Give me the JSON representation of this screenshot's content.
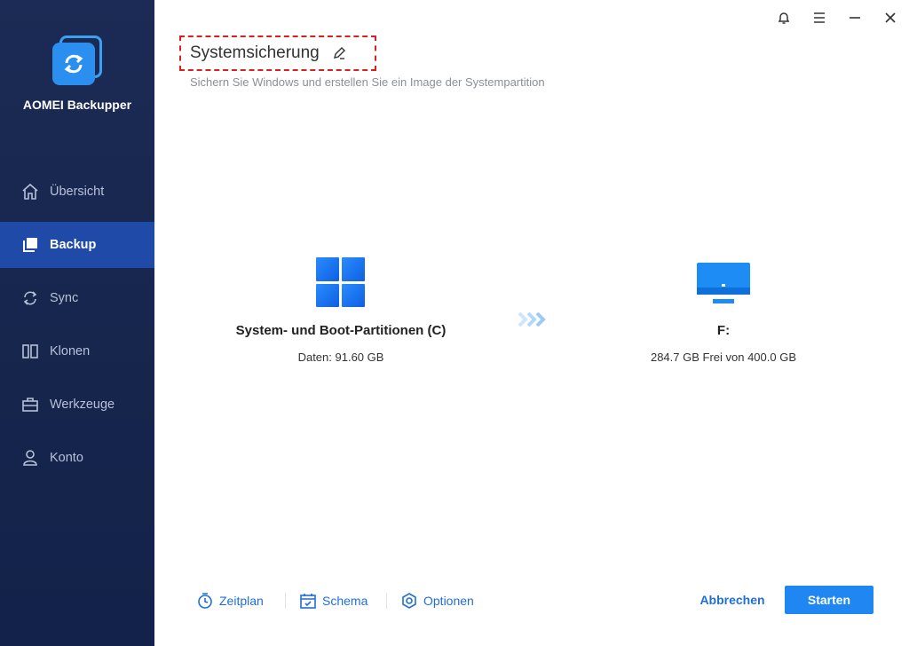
{
  "app": {
    "name": "AOMEI Backupper",
    "logo_icon": "sync-arrows-icon"
  },
  "sidebar": {
    "items": [
      {
        "label": "Übersicht",
        "icon": "home-icon",
        "active": false
      },
      {
        "label": "Backup",
        "icon": "backup-icon",
        "active": true
      },
      {
        "label": "Sync",
        "icon": "sync-icon",
        "active": false
      },
      {
        "label": "Klonen",
        "icon": "clone-icon",
        "active": false
      },
      {
        "label": "Werkzeuge",
        "icon": "toolbox-icon",
        "active": false
      },
      {
        "label": "Konto",
        "icon": "user-icon",
        "active": false
      }
    ]
  },
  "titlebar": {
    "icons": [
      "bell-icon",
      "menu-icon",
      "minimize-icon",
      "close-icon"
    ]
  },
  "header": {
    "title": "Systemsicherung",
    "subtitle": "Sichern Sie Windows und erstellen Sie ein Image der Systempartition"
  },
  "source": {
    "title": "System- und Boot-Partitionen (C)",
    "detail": "Daten: 91.60 GB",
    "icon": "windows-icon"
  },
  "destination": {
    "title": "F:",
    "detail": "284.7 GB Frei von 400.0 GB",
    "icon": "monitor-icon"
  },
  "footer": {
    "schedule": "Zeitplan",
    "scheme": "Schema",
    "options": "Optionen",
    "cancel": "Abbrechen",
    "start": "Starten"
  },
  "colors": {
    "sidebar_bg": "#1b2b55",
    "active_item": "#1f4aa8",
    "accent": "#1f86f2",
    "highlight_border": "#d8201f"
  }
}
